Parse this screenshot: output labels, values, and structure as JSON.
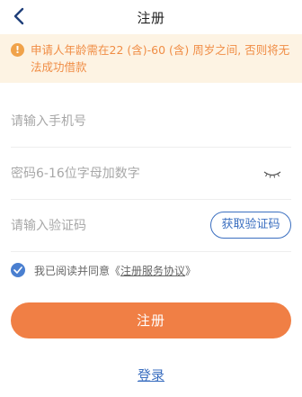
{
  "nav": {
    "title": "注册"
  },
  "notice": {
    "text": "申请人年龄需在22 (含)-60 (含) 周岁之间, 否则将无法成功借款"
  },
  "form": {
    "phone_placeholder": "请输入手机号",
    "password_placeholder": "密码6-16位字母加数字",
    "code_placeholder": "请输入验证码",
    "get_code_label": "获取验证码"
  },
  "agreement": {
    "prefix": "我已阅读并同意《",
    "link_text": "注册服务协议",
    "suffix": "》",
    "checked": true
  },
  "submit_label": "注册",
  "login_label": "登录",
  "colors": {
    "accent": "#f07f45",
    "link_blue": "#3b6fc0",
    "notice_bg": "#fdf3e3",
    "notice_text": "#f08d45"
  }
}
